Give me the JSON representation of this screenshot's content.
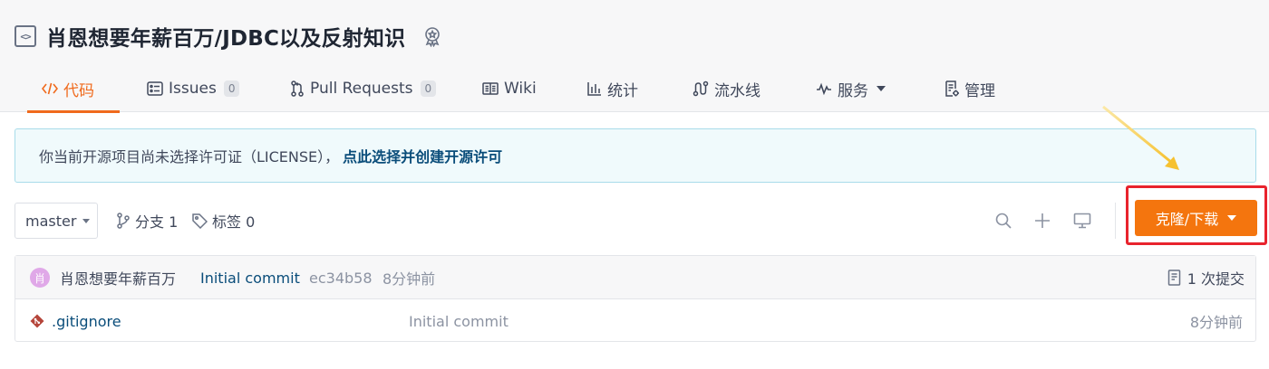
{
  "repo": {
    "title": "肖恩想要年薪百万/JDBC以及反射知识",
    "type_icon": "code-bracket-icon",
    "badge_icon": "recommend-badge-icon"
  },
  "tabs": [
    {
      "label": "代码",
      "icon": "code-icon",
      "active": true
    },
    {
      "label": "Issues",
      "icon": "issues-icon",
      "count": "0"
    },
    {
      "label": "Pull Requests",
      "icon": "pull-request-icon",
      "count": "0"
    },
    {
      "label": "Wiki",
      "icon": "book-icon"
    },
    {
      "label": "统计",
      "icon": "bar-chart-icon"
    },
    {
      "label": "流水线",
      "icon": "pipeline-icon"
    },
    {
      "label": "服务",
      "icon": "pulse-icon",
      "dropdown": true
    },
    {
      "label": "管理",
      "icon": "settings-doc-icon"
    }
  ],
  "notice": {
    "text": "你当前开源项目尚未选择许可证（LICENSE），",
    "link": "点此选择并创建开源许可"
  },
  "toolbar": {
    "branch": "master",
    "branches_label": "分支 1",
    "tags_label": "标签 0",
    "clone_label": "克隆/下载"
  },
  "latest_commit": {
    "avatar_char": "肖",
    "author": "肖恩想要年薪百万",
    "message": "Initial commit",
    "sha": "ec34b58",
    "time": "8分钟前",
    "commit_count": "1 次提交"
  },
  "files": [
    {
      "name": ".gitignore",
      "message": "Initial commit",
      "time": "8分钟前",
      "icon": "git-file-icon"
    }
  ],
  "colors": {
    "accent": "#f06a1c",
    "clone_button": "#f4750e",
    "link": "#0a4d7a",
    "highlight": "#e8232d",
    "arrow": "#f6c12f"
  }
}
